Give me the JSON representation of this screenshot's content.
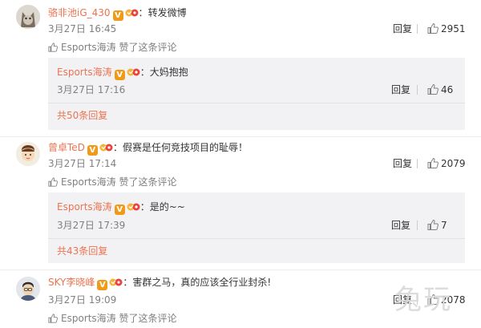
{
  "colors": {
    "username": "#eb7350",
    "vip_badge": "#f09a1a",
    "meta": "#808080",
    "reply_bg": "#f2f2f5"
  },
  "icons": {
    "verified": "V",
    "like": "thumb-up-icon",
    "fan_badge": "fan-badge-icon"
  },
  "comments": [
    {
      "username": "骆非池iG_430",
      "text": "转发微博",
      "time": "3月27日 16:45",
      "reply_label": "回复",
      "likes": "2951",
      "liked_by": "Esports海涛 赞了这条评论",
      "reply": {
        "username": "Esports海涛",
        "text": "大妈抱抱",
        "time": "3月27日 17:16",
        "reply_label": "回复",
        "likes": "46",
        "more": "共50条回复"
      }
    },
    {
      "username": "曾卓TeD",
      "text": "假赛是任何竞技项目的耻辱！",
      "time": "3月27日 17:14",
      "reply_label": "回复",
      "likes": "2079",
      "liked_by": "Esports海涛 赞了这条评论",
      "reply": {
        "username": "Esports海涛",
        "text": "是的~~",
        "time": "3月27日 17:39",
        "reply_label": "回复",
        "likes": "7",
        "more": "共43条回复"
      }
    },
    {
      "username": "SKY李晓峰",
      "text": "害群之马，真的应该全行业封杀!",
      "time": "3月27日 19:09",
      "reply_label": "回复",
      "likes": "2078",
      "liked_by": "Esports海涛 赞了这条评论"
    }
  ],
  "separator": "：",
  "watermark": "兔玩"
}
